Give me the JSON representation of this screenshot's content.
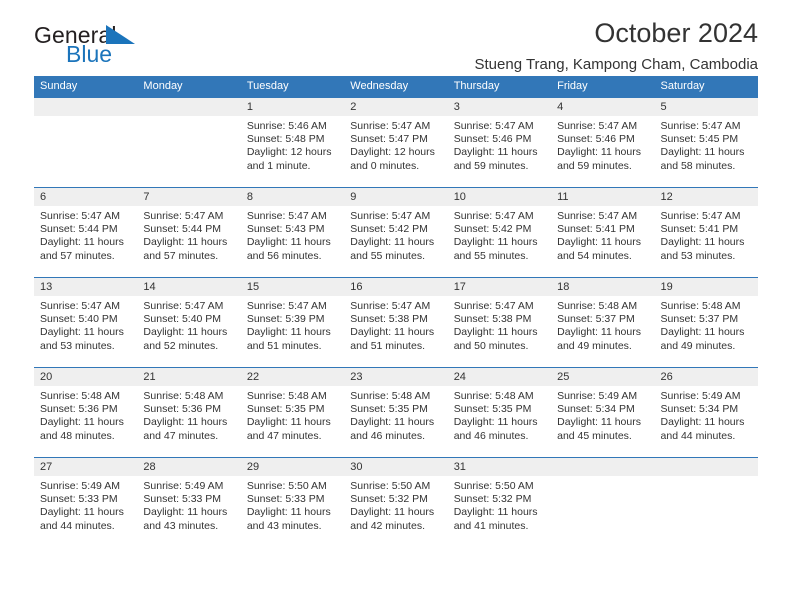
{
  "brand": {
    "name_part1": "General",
    "name_part2": "Blue",
    "mark_icon": "triangle-flag-icon",
    "color_text": "#231f20",
    "color_blue": "#1b74bb"
  },
  "header": {
    "title": "October 2024",
    "location": "Stueng Trang, Kampong Cham, Cambodia"
  },
  "theme": {
    "header_blue": "#3277b8",
    "day_band_gray": "#efefef",
    "text": "#333333"
  },
  "weekdays": [
    "Sunday",
    "Monday",
    "Tuesday",
    "Wednesday",
    "Thursday",
    "Friday",
    "Saturday"
  ],
  "weeks": [
    [
      {
        "day": "",
        "sunrise": "",
        "sunset": "",
        "daylight_line1": "",
        "daylight_line2": ""
      },
      {
        "day": "",
        "sunrise": "",
        "sunset": "",
        "daylight_line1": "",
        "daylight_line2": ""
      },
      {
        "day": "1",
        "sunrise": "Sunrise: 5:46 AM",
        "sunset": "Sunset: 5:48 PM",
        "daylight_line1": "Daylight: 12 hours",
        "daylight_line2": "and 1 minute."
      },
      {
        "day": "2",
        "sunrise": "Sunrise: 5:47 AM",
        "sunset": "Sunset: 5:47 PM",
        "daylight_line1": "Daylight: 12 hours",
        "daylight_line2": "and 0 minutes."
      },
      {
        "day": "3",
        "sunrise": "Sunrise: 5:47 AM",
        "sunset": "Sunset: 5:46 PM",
        "daylight_line1": "Daylight: 11 hours",
        "daylight_line2": "and 59 minutes."
      },
      {
        "day": "4",
        "sunrise": "Sunrise: 5:47 AM",
        "sunset": "Sunset: 5:46 PM",
        "daylight_line1": "Daylight: 11 hours",
        "daylight_line2": "and 59 minutes."
      },
      {
        "day": "5",
        "sunrise": "Sunrise: 5:47 AM",
        "sunset": "Sunset: 5:45 PM",
        "daylight_line1": "Daylight: 11 hours",
        "daylight_line2": "and 58 minutes."
      }
    ],
    [
      {
        "day": "6",
        "sunrise": "Sunrise: 5:47 AM",
        "sunset": "Sunset: 5:44 PM",
        "daylight_line1": "Daylight: 11 hours",
        "daylight_line2": "and 57 minutes."
      },
      {
        "day": "7",
        "sunrise": "Sunrise: 5:47 AM",
        "sunset": "Sunset: 5:44 PM",
        "daylight_line1": "Daylight: 11 hours",
        "daylight_line2": "and 57 minutes."
      },
      {
        "day": "8",
        "sunrise": "Sunrise: 5:47 AM",
        "sunset": "Sunset: 5:43 PM",
        "daylight_line1": "Daylight: 11 hours",
        "daylight_line2": "and 56 minutes."
      },
      {
        "day": "9",
        "sunrise": "Sunrise: 5:47 AM",
        "sunset": "Sunset: 5:42 PM",
        "daylight_line1": "Daylight: 11 hours",
        "daylight_line2": "and 55 minutes."
      },
      {
        "day": "10",
        "sunrise": "Sunrise: 5:47 AM",
        "sunset": "Sunset: 5:42 PM",
        "daylight_line1": "Daylight: 11 hours",
        "daylight_line2": "and 55 minutes."
      },
      {
        "day": "11",
        "sunrise": "Sunrise: 5:47 AM",
        "sunset": "Sunset: 5:41 PM",
        "daylight_line1": "Daylight: 11 hours",
        "daylight_line2": "and 54 minutes."
      },
      {
        "day": "12",
        "sunrise": "Sunrise: 5:47 AM",
        "sunset": "Sunset: 5:41 PM",
        "daylight_line1": "Daylight: 11 hours",
        "daylight_line2": "and 53 minutes."
      }
    ],
    [
      {
        "day": "13",
        "sunrise": "Sunrise: 5:47 AM",
        "sunset": "Sunset: 5:40 PM",
        "daylight_line1": "Daylight: 11 hours",
        "daylight_line2": "and 53 minutes."
      },
      {
        "day": "14",
        "sunrise": "Sunrise: 5:47 AM",
        "sunset": "Sunset: 5:40 PM",
        "daylight_line1": "Daylight: 11 hours",
        "daylight_line2": "and 52 minutes."
      },
      {
        "day": "15",
        "sunrise": "Sunrise: 5:47 AM",
        "sunset": "Sunset: 5:39 PM",
        "daylight_line1": "Daylight: 11 hours",
        "daylight_line2": "and 51 minutes."
      },
      {
        "day": "16",
        "sunrise": "Sunrise: 5:47 AM",
        "sunset": "Sunset: 5:38 PM",
        "daylight_line1": "Daylight: 11 hours",
        "daylight_line2": "and 51 minutes."
      },
      {
        "day": "17",
        "sunrise": "Sunrise: 5:47 AM",
        "sunset": "Sunset: 5:38 PM",
        "daylight_line1": "Daylight: 11 hours",
        "daylight_line2": "and 50 minutes."
      },
      {
        "day": "18",
        "sunrise": "Sunrise: 5:48 AM",
        "sunset": "Sunset: 5:37 PM",
        "daylight_line1": "Daylight: 11 hours",
        "daylight_line2": "and 49 minutes."
      },
      {
        "day": "19",
        "sunrise": "Sunrise: 5:48 AM",
        "sunset": "Sunset: 5:37 PM",
        "daylight_line1": "Daylight: 11 hours",
        "daylight_line2": "and 49 minutes."
      }
    ],
    [
      {
        "day": "20",
        "sunrise": "Sunrise: 5:48 AM",
        "sunset": "Sunset: 5:36 PM",
        "daylight_line1": "Daylight: 11 hours",
        "daylight_line2": "and 48 minutes."
      },
      {
        "day": "21",
        "sunrise": "Sunrise: 5:48 AM",
        "sunset": "Sunset: 5:36 PM",
        "daylight_line1": "Daylight: 11 hours",
        "daylight_line2": "and 47 minutes."
      },
      {
        "day": "22",
        "sunrise": "Sunrise: 5:48 AM",
        "sunset": "Sunset: 5:35 PM",
        "daylight_line1": "Daylight: 11 hours",
        "daylight_line2": "and 47 minutes."
      },
      {
        "day": "23",
        "sunrise": "Sunrise: 5:48 AM",
        "sunset": "Sunset: 5:35 PM",
        "daylight_line1": "Daylight: 11 hours",
        "daylight_line2": "and 46 minutes."
      },
      {
        "day": "24",
        "sunrise": "Sunrise: 5:48 AM",
        "sunset": "Sunset: 5:35 PM",
        "daylight_line1": "Daylight: 11 hours",
        "daylight_line2": "and 46 minutes."
      },
      {
        "day": "25",
        "sunrise": "Sunrise: 5:49 AM",
        "sunset": "Sunset: 5:34 PM",
        "daylight_line1": "Daylight: 11 hours",
        "daylight_line2": "and 45 minutes."
      },
      {
        "day": "26",
        "sunrise": "Sunrise: 5:49 AM",
        "sunset": "Sunset: 5:34 PM",
        "daylight_line1": "Daylight: 11 hours",
        "daylight_line2": "and 44 minutes."
      }
    ],
    [
      {
        "day": "27",
        "sunrise": "Sunrise: 5:49 AM",
        "sunset": "Sunset: 5:33 PM",
        "daylight_line1": "Daylight: 11 hours",
        "daylight_line2": "and 44 minutes."
      },
      {
        "day": "28",
        "sunrise": "Sunrise: 5:49 AM",
        "sunset": "Sunset: 5:33 PM",
        "daylight_line1": "Daylight: 11 hours",
        "daylight_line2": "and 43 minutes."
      },
      {
        "day": "29",
        "sunrise": "Sunrise: 5:50 AM",
        "sunset": "Sunset: 5:33 PM",
        "daylight_line1": "Daylight: 11 hours",
        "daylight_line2": "and 43 minutes."
      },
      {
        "day": "30",
        "sunrise": "Sunrise: 5:50 AM",
        "sunset": "Sunset: 5:32 PM",
        "daylight_line1": "Daylight: 11 hours",
        "daylight_line2": "and 42 minutes."
      },
      {
        "day": "31",
        "sunrise": "Sunrise: 5:50 AM",
        "sunset": "Sunset: 5:32 PM",
        "daylight_line1": "Daylight: 11 hours",
        "daylight_line2": "and 41 minutes."
      },
      {
        "day": "",
        "sunrise": "",
        "sunset": "",
        "daylight_line1": "",
        "daylight_line2": ""
      },
      {
        "day": "",
        "sunrise": "",
        "sunset": "",
        "daylight_line1": "",
        "daylight_line2": ""
      }
    ]
  ]
}
